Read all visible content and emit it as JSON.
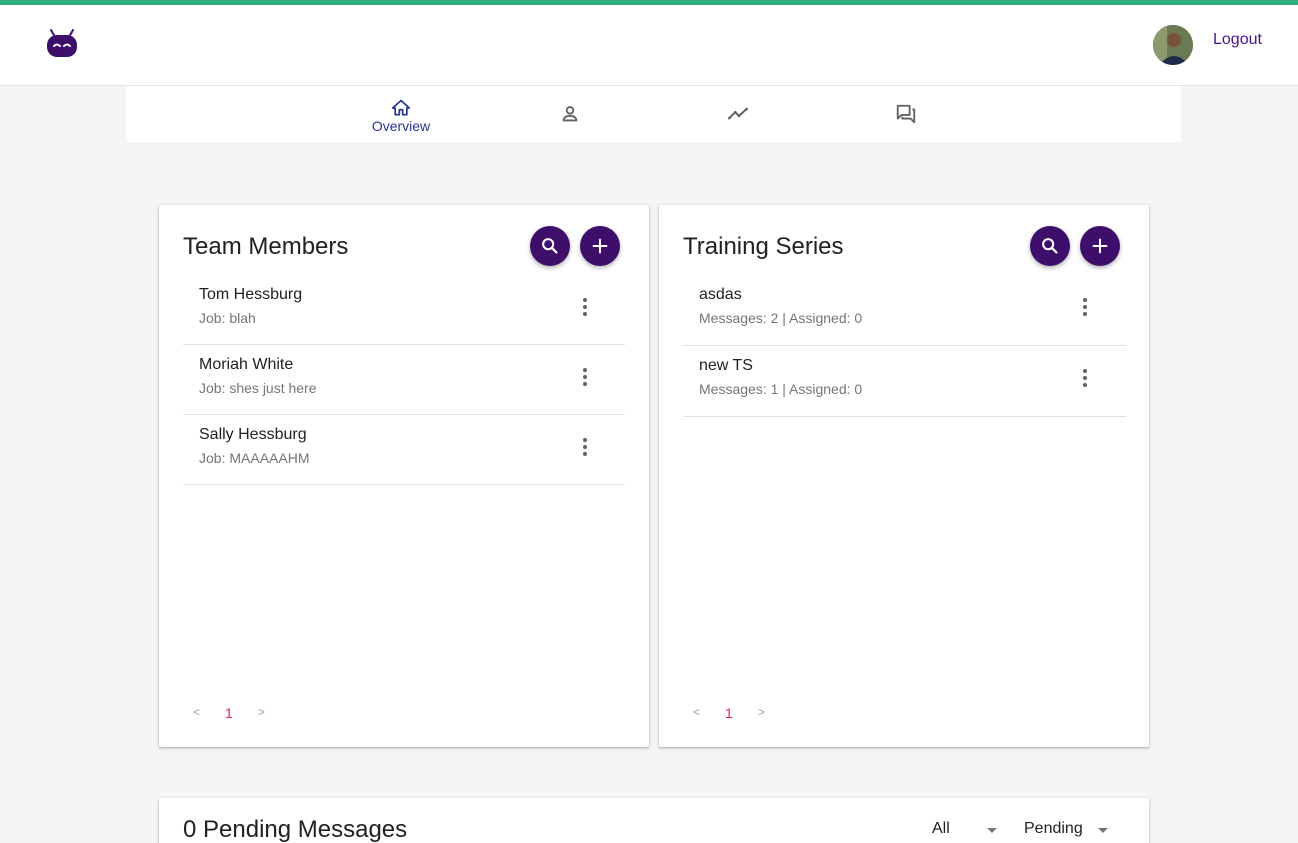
{
  "header": {
    "logout_label": "Logout",
    "accent_color": "#2eaf7d",
    "brand_color": "#3d0f6b"
  },
  "tabs": [
    {
      "label": "Overview",
      "icon": "home-icon",
      "active": true
    },
    {
      "label": "",
      "icon": "person-icon",
      "active": false
    },
    {
      "label": "",
      "icon": "trending-icon",
      "active": false
    },
    {
      "label": "",
      "icon": "forum-icon",
      "active": false
    }
  ],
  "team_members": {
    "title": "Team Members",
    "items": [
      {
        "name": "Tom Hessburg",
        "job": "Job: blah"
      },
      {
        "name": "Moriah White",
        "job": "Job: shes just here"
      },
      {
        "name": "Sally Hessburg",
        "job": "Job: MAAAAAHM"
      }
    ],
    "pager": {
      "prev": "<",
      "page": "1",
      "next": ">"
    }
  },
  "training_series": {
    "title": "Training Series",
    "items": [
      {
        "name": "asdas",
        "meta": "Messages: 2 | Assigned: 0"
      },
      {
        "name": "new TS",
        "meta": "Messages: 1 | Assigned: 0"
      }
    ],
    "pager": {
      "prev": "<",
      "page": "1",
      "next": ">"
    }
  },
  "pending_messages": {
    "title": "0 Pending Messages",
    "filter_audience": "All",
    "filter_status": "Pending"
  }
}
